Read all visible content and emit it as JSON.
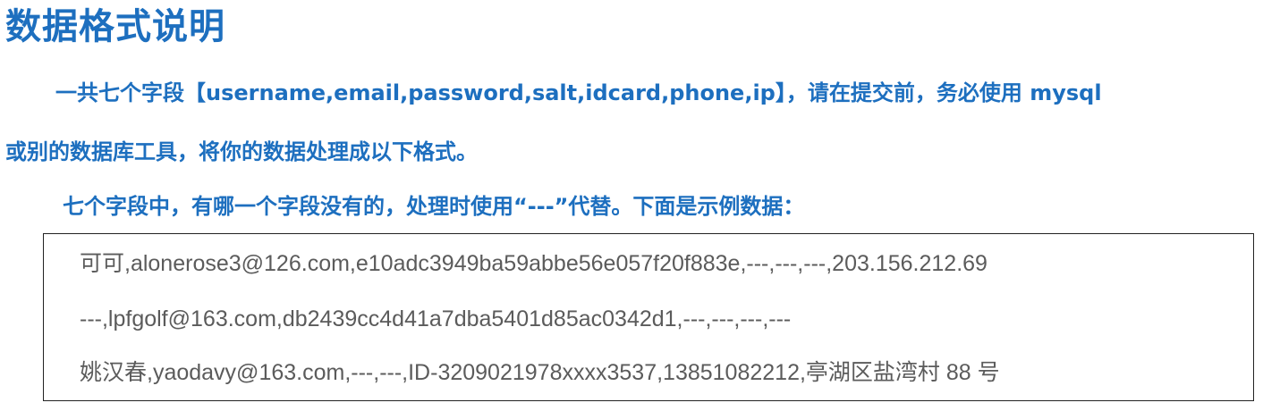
{
  "document": {
    "title": "数据格式说明",
    "paragraphs": [
      "一共七个字段【username,email,password,salt,idcard,phone,ip】，请在提交前，务必使用 mysql",
      "或别的数据库工具，将你的数据处理成以下格式。",
      "七个字段中，有哪一个字段没有的，处理时使用“---”代替。下面是示例数据："
    ],
    "sample_lines": [
      "可可,alonerose3@126.com,e10adc3949ba59abbe56e057f20f883e,---,---,---,203.156.212.69",
      "---,lpfgolf@163.com,db2439cc4d41a7dba5401d85ac0342d1,---,---,---,---",
      "姚汉春,yaodavy@163.com,---,---,ID-3209021978xxxx3537,13851082212,亭湖区盐湾村 88 号"
    ]
  },
  "colors": {
    "heading_blue": "#1d6fbf",
    "sample_text_gray": "#5b5b5b",
    "box_border": "#222222"
  }
}
